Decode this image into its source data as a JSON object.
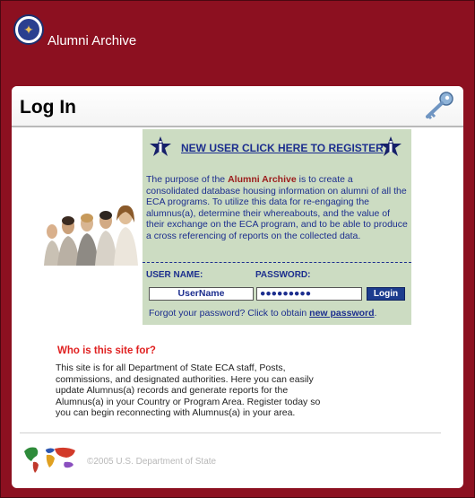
{
  "header": {
    "app_title": "Alumni Archive",
    "seal_icon": "state-department-seal-icon"
  },
  "page": {
    "title": "Log In",
    "header_icon": "key-icon"
  },
  "register_box": {
    "register_link": "NEW USER CLICK HERE TO REGISTER",
    "purpose_prefix": "The purpose of the ",
    "purpose_highlight": "Alumni Archive",
    "purpose_rest": " is to create a consolidated database housing information on alumni of all the ECA programs. To utilize this data for re-engaging the alumnus(a), determine their whereabouts, and the value of their exchange on the ECA program, and to be able to produce a cross referencing of reports on the collected data.",
    "username_label": "USER NAME:",
    "password_label": "PASSWORD:",
    "username_value": "UserName",
    "password_value": "●●●●●●●●●",
    "login_button": "Login",
    "forgot_text": "Forgot your password?  Click to obtain ",
    "new_password_link": "new password",
    "forgot_suffix": "."
  },
  "info": {
    "title": "Who is this site for?",
    "body": "This site is for all Department of State ECA staff, Posts, commissions, and designated authorities. Here you can easily update Alumnus(a) records and generate reports for the Alumnus(a) in your Country or Program Area. Register today so you can begin reconnecting with Alumnus(a) in your area."
  },
  "footer": {
    "copyright": "©2005 U.S. Department of State",
    "map_icon": "world-map-icon"
  },
  "colors": {
    "frame": "#8c1020",
    "register_box": "#ccdcc2",
    "link_blue": "#1c2e8e",
    "highlight_red": "#9c1b1b",
    "who_title": "#e02020"
  }
}
